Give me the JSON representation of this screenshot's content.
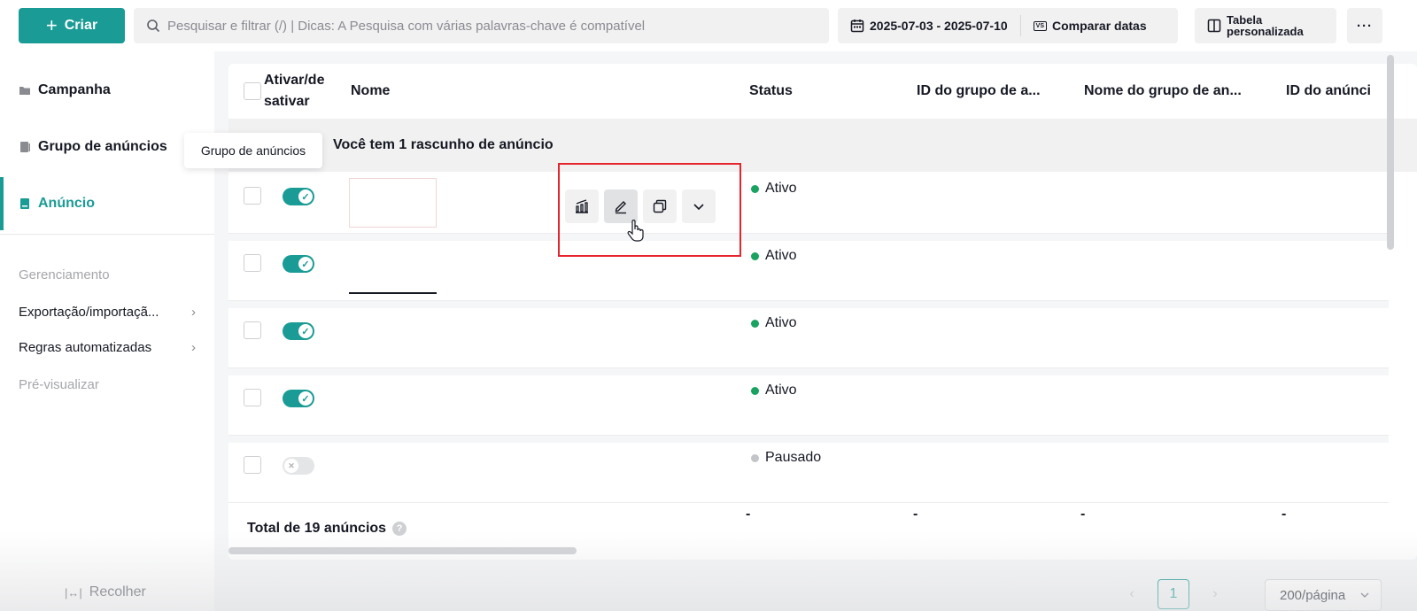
{
  "toolbar": {
    "create_label": "Criar",
    "search_placeholder": "Pesquisar e filtrar (/) | Dicas: A Pesquisa com várias palavras-chave é compatível",
    "date_range": "2025-07-03 - 2025-07-10",
    "compare_icon_text": "VS",
    "compare_label": "Comparar datas",
    "custom_table_label_1": "Tabela",
    "custom_table_label_2": "personalizada",
    "more_label": "···"
  },
  "sidebar": {
    "campaign": "Campanha",
    "ad_group": "Grupo de anúncios",
    "ad": "Anúncio",
    "management_title": "Gerenciamento",
    "export_import": "Exportação/importaçã...",
    "automated_rules": "Regras automatizadas",
    "preview": "Pré-visualizar",
    "collapse": "Recolher",
    "tooltip": "Grupo de anúncios"
  },
  "table": {
    "columns": {
      "toggle_1": "Ativar/de",
      "toggle_2": "sativar",
      "name": "Nome",
      "status": "Status",
      "ad_group_id": "ID do grupo de a...",
      "ad_group_name": "Nome do grupo de an...",
      "ad_id": "ID do anúnci"
    },
    "draft_message": "Você tem 1 rascunho de anúncio",
    "rows": [
      {
        "status": "Ativo",
        "enabled": true
      },
      {
        "status": "Ativo",
        "enabled": true
      },
      {
        "status": "Ativo",
        "enabled": true
      },
      {
        "status": "Ativo",
        "enabled": true
      },
      {
        "status": "Pausado",
        "enabled": false
      }
    ],
    "total_label": "Total de 19 anúncios",
    "total_dash": "-"
  },
  "pagination": {
    "current_page": "1",
    "per_page": "200/página"
  },
  "colors": {
    "accent": "#1a9b95",
    "active_status": "#1aa260",
    "highlight": "#e5242b"
  }
}
